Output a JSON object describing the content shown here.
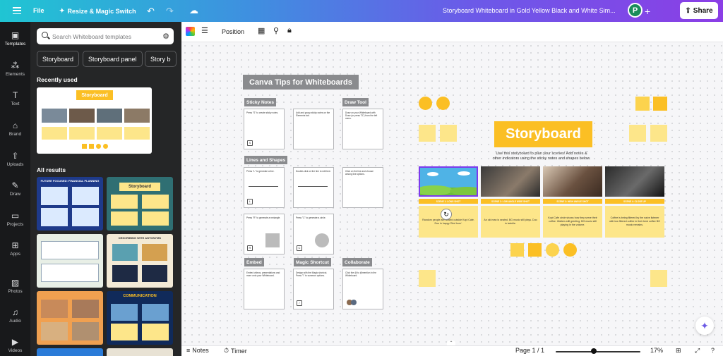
{
  "topbar": {
    "file": "File",
    "resize": "Resize & Magic Switch",
    "doc_title": "Storyboard Whiteboard in Gold Yellow Black and White Sim...",
    "avatar": "P",
    "share": "Share"
  },
  "rail": [
    {
      "label": "Templates",
      "icon": "templates-icon"
    },
    {
      "label": "Elements",
      "icon": "elements-icon"
    },
    {
      "label": "Text",
      "icon": "text-icon"
    },
    {
      "label": "Brand",
      "icon": "brand-icon"
    },
    {
      "label": "Uploads",
      "icon": "uploads-icon"
    },
    {
      "label": "Draw",
      "icon": "draw-icon"
    },
    {
      "label": "Projects",
      "icon": "projects-icon"
    },
    {
      "label": "Apps",
      "icon": "apps-icon"
    },
    {
      "label": "Photos",
      "icon": "photos-icon"
    },
    {
      "label": "Audio",
      "icon": "audio-icon"
    },
    {
      "label": "Videos",
      "icon": "videos-icon"
    }
  ],
  "panel": {
    "search_placeholder": "Search Whiteboard templates",
    "chips": [
      "Storyboard",
      "Storyboard panel",
      "Story b"
    ],
    "recently_used": "Recently used",
    "recent_title": "Storyboard",
    "all_results": "All results",
    "results": [
      {
        "title": "FUTURE FOCUSED: FINANCIAL PLANNING"
      },
      {
        "title": "Storyboard"
      },
      {
        "title": ""
      },
      {
        "title": "DESCRIBING WITH ANTONYMS"
      },
      {
        "title": ""
      },
      {
        "title": "COMMUNICATION"
      }
    ]
  },
  "toolbar": {
    "position": "Position"
  },
  "canvas": {
    "tips_title": "Canva Tips for Whiteboards",
    "labels": {
      "sticky_notes": "Sticky Notes",
      "draw_tool": "Draw Tool",
      "lines_shapes": "Lines and Shapes",
      "embed": "Embed",
      "magic_shortcut": "Magic Shortcut",
      "collaborate": "Collaborate"
    },
    "cards": [
      {
        "text": "Press \"S\" to create sticky notes.",
        "key": "S"
      },
      {
        "text": "Add and group sticky notes on the Elements tab.",
        "key": ""
      },
      {
        "text": "Draw on your Whiteboard with Draw (or press \"D\") from the left menu.",
        "key": ""
      },
      {
        "text": "Press \"L\" to generate a line.",
        "key": "L"
      },
      {
        "text": "Double-click on the line to edit text.",
        "key": ""
      },
      {
        "text": "Click on the line and choose among line options.",
        "key": ""
      },
      {
        "text": "Press \"R\" to generate a rectangle.",
        "key": "R"
      },
      {
        "text": "Press \"C\" to generate a circle.",
        "key": "C"
      },
      {
        "text": "Embed videos, presentations and more onto your Whiteboard.",
        "key": ""
      },
      {
        "text": "Design with the Magic shortcut. Press \"/\" to summon options.",
        "key": "/"
      },
      {
        "text": "Click the @ to @mention in the Whiteboard.",
        "key": ""
      }
    ],
    "storyboard_title": "Storyboard",
    "storyboard_sub": "Use this storyboard to plan your scenes! Add notes & other indicators using the sticky notes and shapes below.",
    "scenes": [
      {
        "label": "SCENE 1: LONG SHOT",
        "text": "Random people are seated outside Kopi Cafe. Duo in happy 'Bird hum'."
      },
      {
        "label": "SCENE 2: LOW ANGLE WIDE SHOT",
        "text": "An old man is seated. BG music still plays. Duo in twinkle."
      },
      {
        "label": "SCENE 3: HIGH ANGLE SHOT",
        "text": "Kopi Cafe circle shows how they serve their coffee. Waiters still greeting. BG music still playing in the volume."
      },
      {
        "label": "SCENE 4: CLOSE UP",
        "text": "Coffee is being filtered by the naive listener with low filtered coffee in their best coffee BG music remains."
      }
    ]
  },
  "bottombar": {
    "notes": "Notes",
    "timer": "Timer",
    "page": "Page 1 / 1",
    "zoom": "17%"
  },
  "colors": {
    "accent_yellow": "#fbbf24",
    "sticky_yellow": "#fde68a",
    "gray_label": "#8a8b8e"
  }
}
